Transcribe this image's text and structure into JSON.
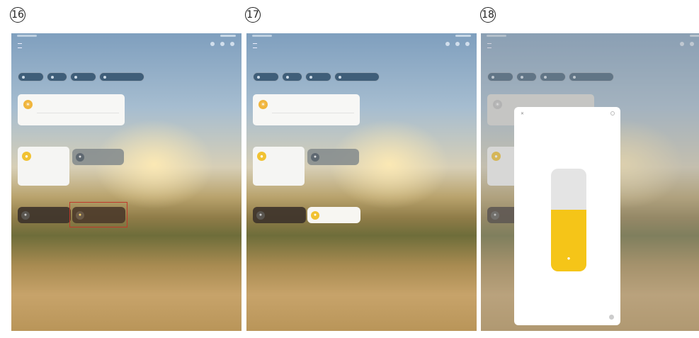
{
  "steps": [
    "16",
    "17",
    "18"
  ],
  "colors": {
    "accent_yellow": "#f5c518",
    "highlight_red": "#c0392b"
  },
  "icons": {
    "bulb": "bulb-icon",
    "status": "light-status-icon",
    "close": "close-icon",
    "settings": "settings-icon"
  },
  "slider": {
    "brightness_fraction": 0.6
  }
}
